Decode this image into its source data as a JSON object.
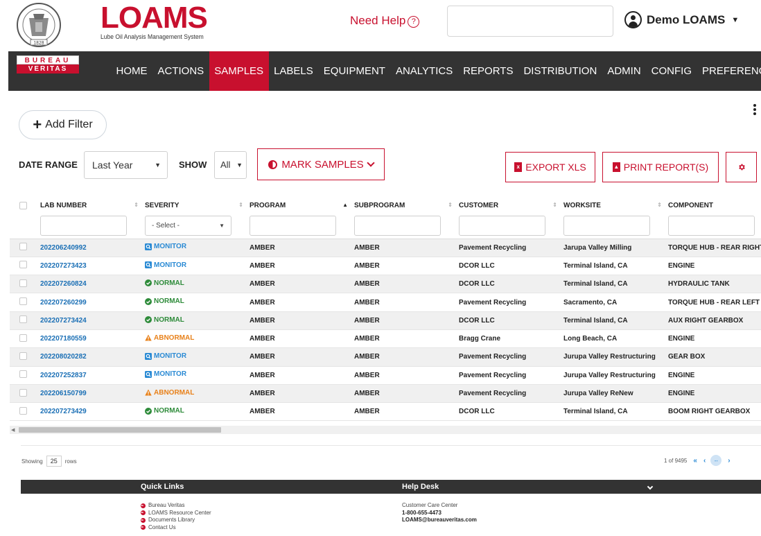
{
  "header": {
    "seal_text": "BUREAU VERITAS 1828",
    "logo_word": "LOAMS",
    "logo_subtitle": "Lube Oil Analysis Management System",
    "help_label": "Need Help",
    "help_icon": "question-circle-icon",
    "user_name": "Demo LOAMS",
    "brand_color": "#c8102e"
  },
  "brand_badge": {
    "top": "BUREAU",
    "bottom": "VERITAS"
  },
  "nav": {
    "items": [
      {
        "label": "HOME",
        "active": false
      },
      {
        "label": "ACTIONS",
        "active": false
      },
      {
        "label": "SAMPLES",
        "active": true
      },
      {
        "label": "LABELS",
        "active": false
      },
      {
        "label": "EQUIPMENT",
        "active": false
      },
      {
        "label": "ANALYTICS",
        "active": false
      },
      {
        "label": "REPORTS",
        "active": false
      },
      {
        "label": "DISTRIBUTION",
        "active": false
      },
      {
        "label": "ADMIN",
        "active": false
      },
      {
        "label": "CONFIG",
        "active": false
      },
      {
        "label": "PREFERENCES",
        "active": false
      }
    ]
  },
  "filters": {
    "add_filter_label": "Add Filter"
  },
  "toolbar": {
    "date_range_label": "DATE RANGE",
    "date_range_value": "Last Year",
    "show_label": "SHOW",
    "show_value": "All",
    "mark_samples_label": "MARK SAMPLES",
    "export_label": "EXPORT XLS",
    "print_label": "PRINT REPORT(S)"
  },
  "table": {
    "columns": {
      "lab_number": "LAB NUMBER",
      "severity": "SEVERITY",
      "program": "PROGRAM",
      "subprogram": "SUBPROGRAM",
      "customer": "CUSTOMER",
      "worksite": "WORKSITE",
      "component": "COMPONENT"
    },
    "severity_placeholder": "- Select -",
    "rows": [
      {
        "lab": "202206240992",
        "severity": "MONITOR",
        "program": "AMBER",
        "subprogram": "AMBER",
        "customer": "Pavement Recycling",
        "worksite": "Jarupa Valley Milling",
        "component": "TORQUE HUB - REAR RIGHT"
      },
      {
        "lab": "202207273423",
        "severity": "MONITOR",
        "program": "AMBER",
        "subprogram": "AMBER",
        "customer": "DCOR LLC",
        "worksite": "Terminal Island, CA",
        "component": "ENGINE"
      },
      {
        "lab": "202207260824",
        "severity": "NORMAL",
        "program": "AMBER",
        "subprogram": "AMBER",
        "customer": "DCOR LLC",
        "worksite": "Terminal Island, CA",
        "component": "HYDRAULIC TANK"
      },
      {
        "lab": "202207260299",
        "severity": "NORMAL",
        "program": "AMBER",
        "subprogram": "AMBER",
        "customer": "Pavement Recycling",
        "worksite": "Sacramento, CA",
        "component": "TORQUE HUB - REAR LEFT"
      },
      {
        "lab": "202207273424",
        "severity": "NORMAL",
        "program": "AMBER",
        "subprogram": "AMBER",
        "customer": "DCOR LLC",
        "worksite": "Terminal Island, CA",
        "component": "AUX RIGHT GEARBOX"
      },
      {
        "lab": "202207180559",
        "severity": "ABNORMAL",
        "program": "AMBER",
        "subprogram": "AMBER",
        "customer": "Bragg Crane",
        "worksite": "Long Beach, CA",
        "component": "ENGINE"
      },
      {
        "lab": "202208020282",
        "severity": "MONITOR",
        "program": "AMBER",
        "subprogram": "AMBER",
        "customer": "Pavement Recycling",
        "worksite": "Jurupa Valley Restructuring",
        "component": "GEAR BOX"
      },
      {
        "lab": "202207252837",
        "severity": "MONITOR",
        "program": "AMBER",
        "subprogram": "AMBER",
        "customer": "Pavement Recycling",
        "worksite": "Jurupa Valley Restructuring",
        "component": "ENGINE"
      },
      {
        "lab": "202206150799",
        "severity": "ABNORMAL",
        "program": "AMBER",
        "subprogram": "AMBER",
        "customer": "Pavement Recycling",
        "worksite": "Jurupa Valley ReNew",
        "component": "ENGINE"
      },
      {
        "lab": "202207273429",
        "severity": "NORMAL",
        "program": "AMBER",
        "subprogram": "AMBER",
        "customer": "DCOR LLC",
        "worksite": "Terminal Island, CA",
        "component": "BOOM RIGHT GEARBOX"
      }
    ],
    "severity_colors": {
      "MONITOR": "#2a8ad4",
      "NORMAL": "#2e8b3a",
      "ABNORMAL": "#e8811a"
    }
  },
  "pager": {
    "showing_label": "Showing",
    "rows_value": "25",
    "rows_label": "rows",
    "page_info": "1 of 9495",
    "current_page": "--"
  },
  "footer": {
    "quick_links_title": "Quick Links",
    "help_desk_title": "Help Desk",
    "quick_links": [
      "Bureau Veritas",
      "LOAMS Resource Center",
      "Documents Library",
      "Contact Us"
    ],
    "help_center": "Customer Care Center",
    "help_phone": "1-800-655-4473",
    "help_email": "LOAMS@bureauveritas.com"
  }
}
